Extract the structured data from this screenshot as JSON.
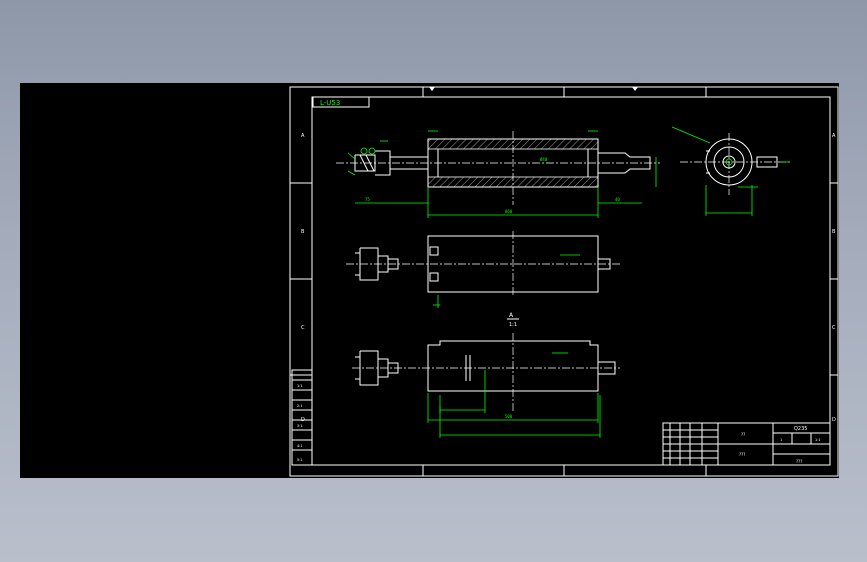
{
  "drawing": {
    "part_number": "L-U53",
    "section_mark": "A",
    "section_scale": "1:1",
    "border_letters": [
      "A",
      "B",
      "C",
      "D"
    ],
    "title_block": {
      "material": "Q235",
      "name_field": "??",
      "drawing_no": "???",
      "company": "???",
      "sheet": "1",
      "scale": "1:1"
    },
    "revision_rows": [
      "1:1",
      "2:1",
      "3:1",
      "4:1",
      "5:1"
    ],
    "dims": {
      "overall": "860",
      "shaft": "500",
      "flange": "75",
      "bore": "Ø40",
      "key": "40"
    }
  }
}
